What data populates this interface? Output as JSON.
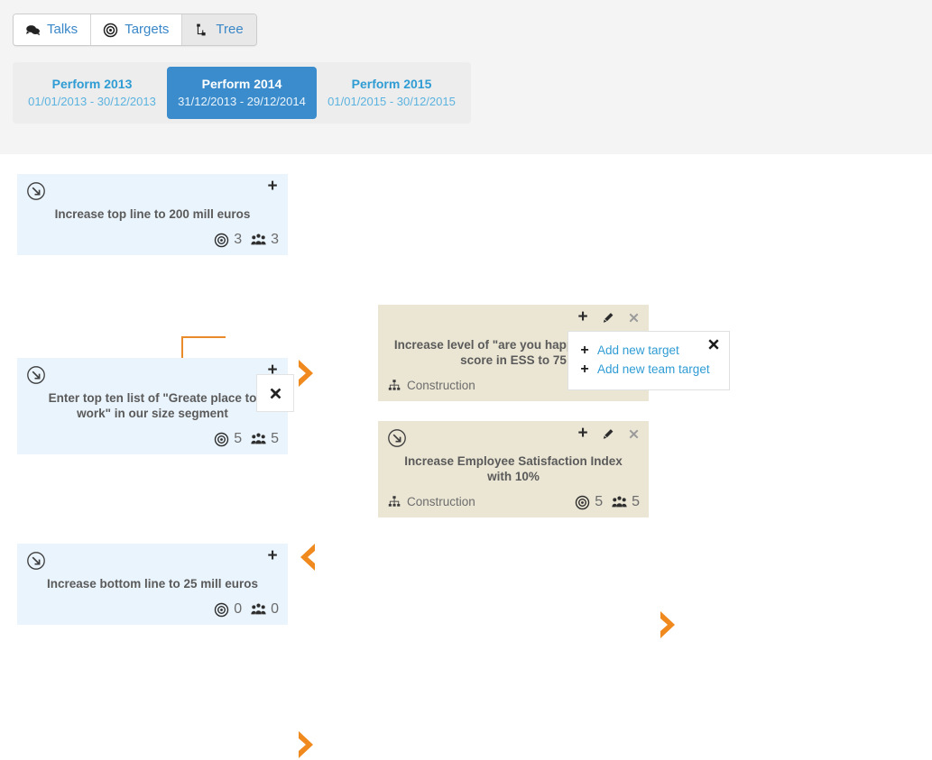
{
  "tabs": [
    {
      "label": "Talks",
      "icon": "comments-icon",
      "active": false
    },
    {
      "label": "Targets",
      "icon": "bullseye-icon",
      "active": false
    },
    {
      "label": "Tree",
      "icon": "sitemap-icon",
      "active": true
    }
  ],
  "periods": [
    {
      "name": "Perform 2013",
      "range": "01/01/2013 - 30/12/2013",
      "selected": false
    },
    {
      "name": "Perform 2014",
      "range": "31/12/2013 - 29/12/2014",
      "selected": true
    },
    {
      "name": "Perform 2015",
      "range": "01/01/2015 - 30/12/2015",
      "selected": false
    }
  ],
  "cards": {
    "top_line": {
      "title": "Increase top line to 200 mill euros",
      "target_count": "3",
      "team_count": "3"
    },
    "top_ten": {
      "title": "Enter top ten list of \"Greate place to work\" in our size segment",
      "target_count": "5",
      "team_count": "5"
    },
    "bottom_line": {
      "title": "Increase bottom line to 25 mill euros",
      "target_count": "0",
      "team_count": "0"
    },
    "ess_score": {
      "title": "Increase level of \"are you happy at work\" score in ESS to 75",
      "org": "Construction"
    },
    "esi_index": {
      "title": "Increase Employee Satisfaction Index with 10%",
      "org": "Construction",
      "target_count": "5",
      "team_count": "5"
    }
  },
  "add_menu": {
    "add_target": "Add new target",
    "add_team_target": "Add new team target"
  },
  "colors": {
    "accent_orange": "#f08a1e",
    "card_blue": "#eaf4fc",
    "card_beige": "#ebe6d4",
    "link_blue": "#2f9cd4",
    "period_selected": "#3b8ccc"
  }
}
